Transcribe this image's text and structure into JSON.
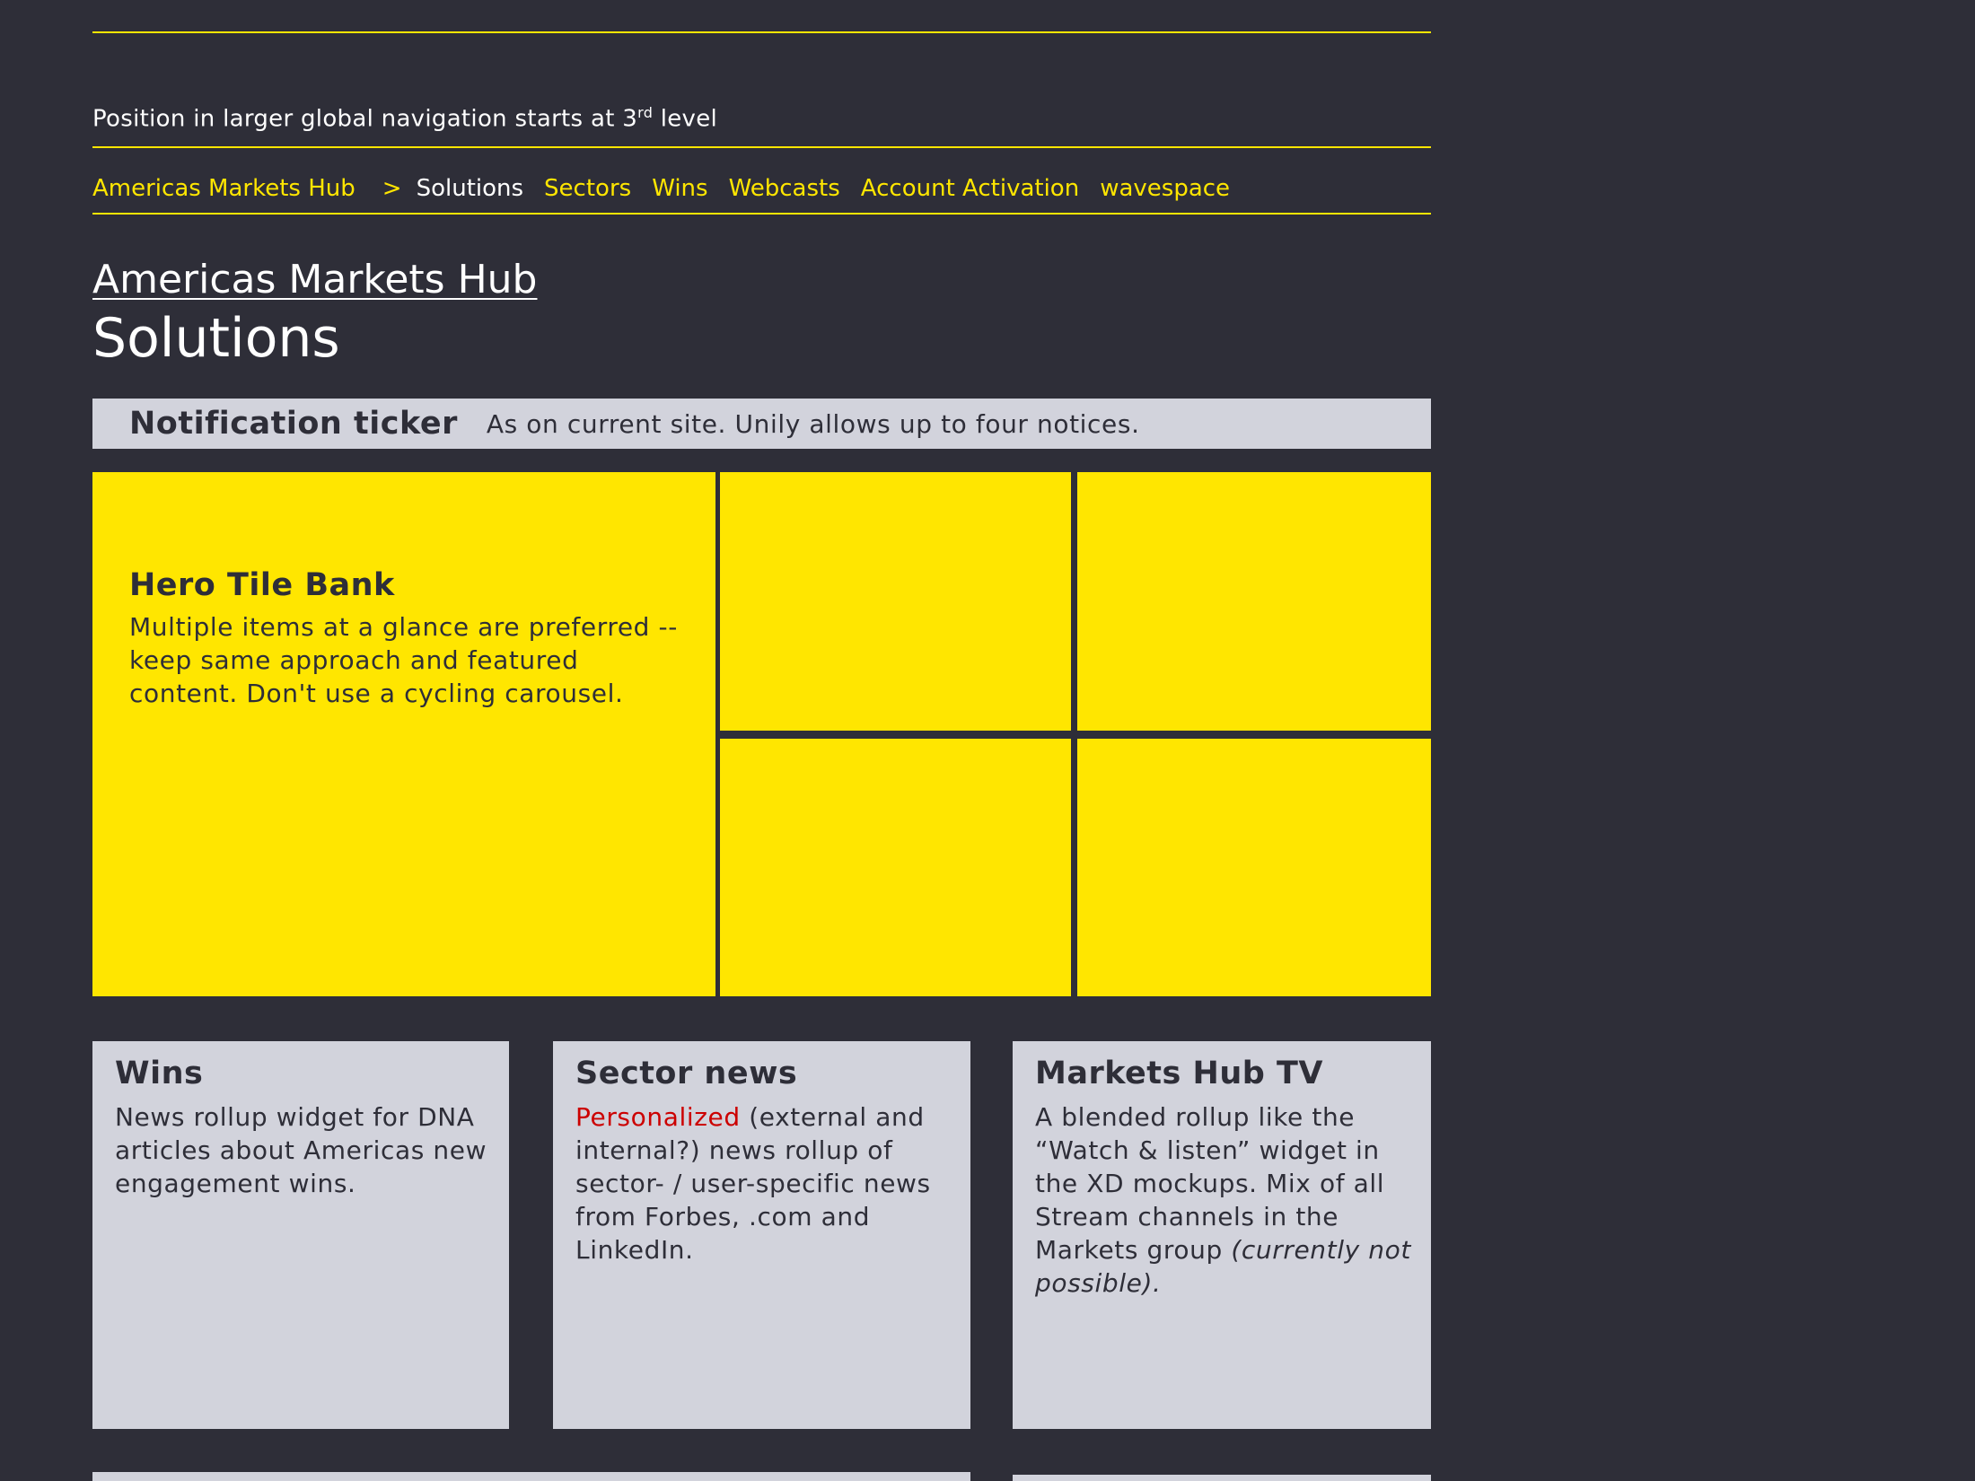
{
  "intro": {
    "text": "Position in larger global navigation starts at 3",
    "sup": "rd",
    "suffix": " level"
  },
  "breadcrumb": {
    "root": "Americas Markets Hub",
    "separator": ">",
    "current": "Solutions",
    "items": [
      "Sectors",
      "Wins",
      "Webcasts",
      "Account Activation",
      "wavespace"
    ]
  },
  "header": {
    "parent_link": "Americas Markets Hub",
    "page_title": "Solutions"
  },
  "ticker": {
    "title": "Notification ticker",
    "description": "As on current site. Unily allows up to four notices."
  },
  "hero": {
    "title": "Hero Tile Bank",
    "description": "Multiple items at a glance are preferred -- keep same approach and featured content. Don't use a cycling carousel."
  },
  "cards": {
    "wins": {
      "title": "Wins",
      "body": "News rollup widget for DNA articles about Americas new engagement wins."
    },
    "sector_news": {
      "title": "Sector news",
      "highlight": "Personalized",
      "body": " (external and internal?) news rollup of sector- / user-specific news from Forbes, .com and LinkedIn."
    },
    "markets_tv": {
      "title": "Markets Hub TV",
      "body": "A blended rollup like the “Watch & listen” widget in the XD mockups. Mix of all Stream channels in the Markets group ",
      "italic": "(currently not possible)."
    }
  },
  "colors": {
    "background": "#2e2e38",
    "accent": "#ffe600",
    "panel": "#d2d3dc",
    "highlight": "#cc0000"
  }
}
